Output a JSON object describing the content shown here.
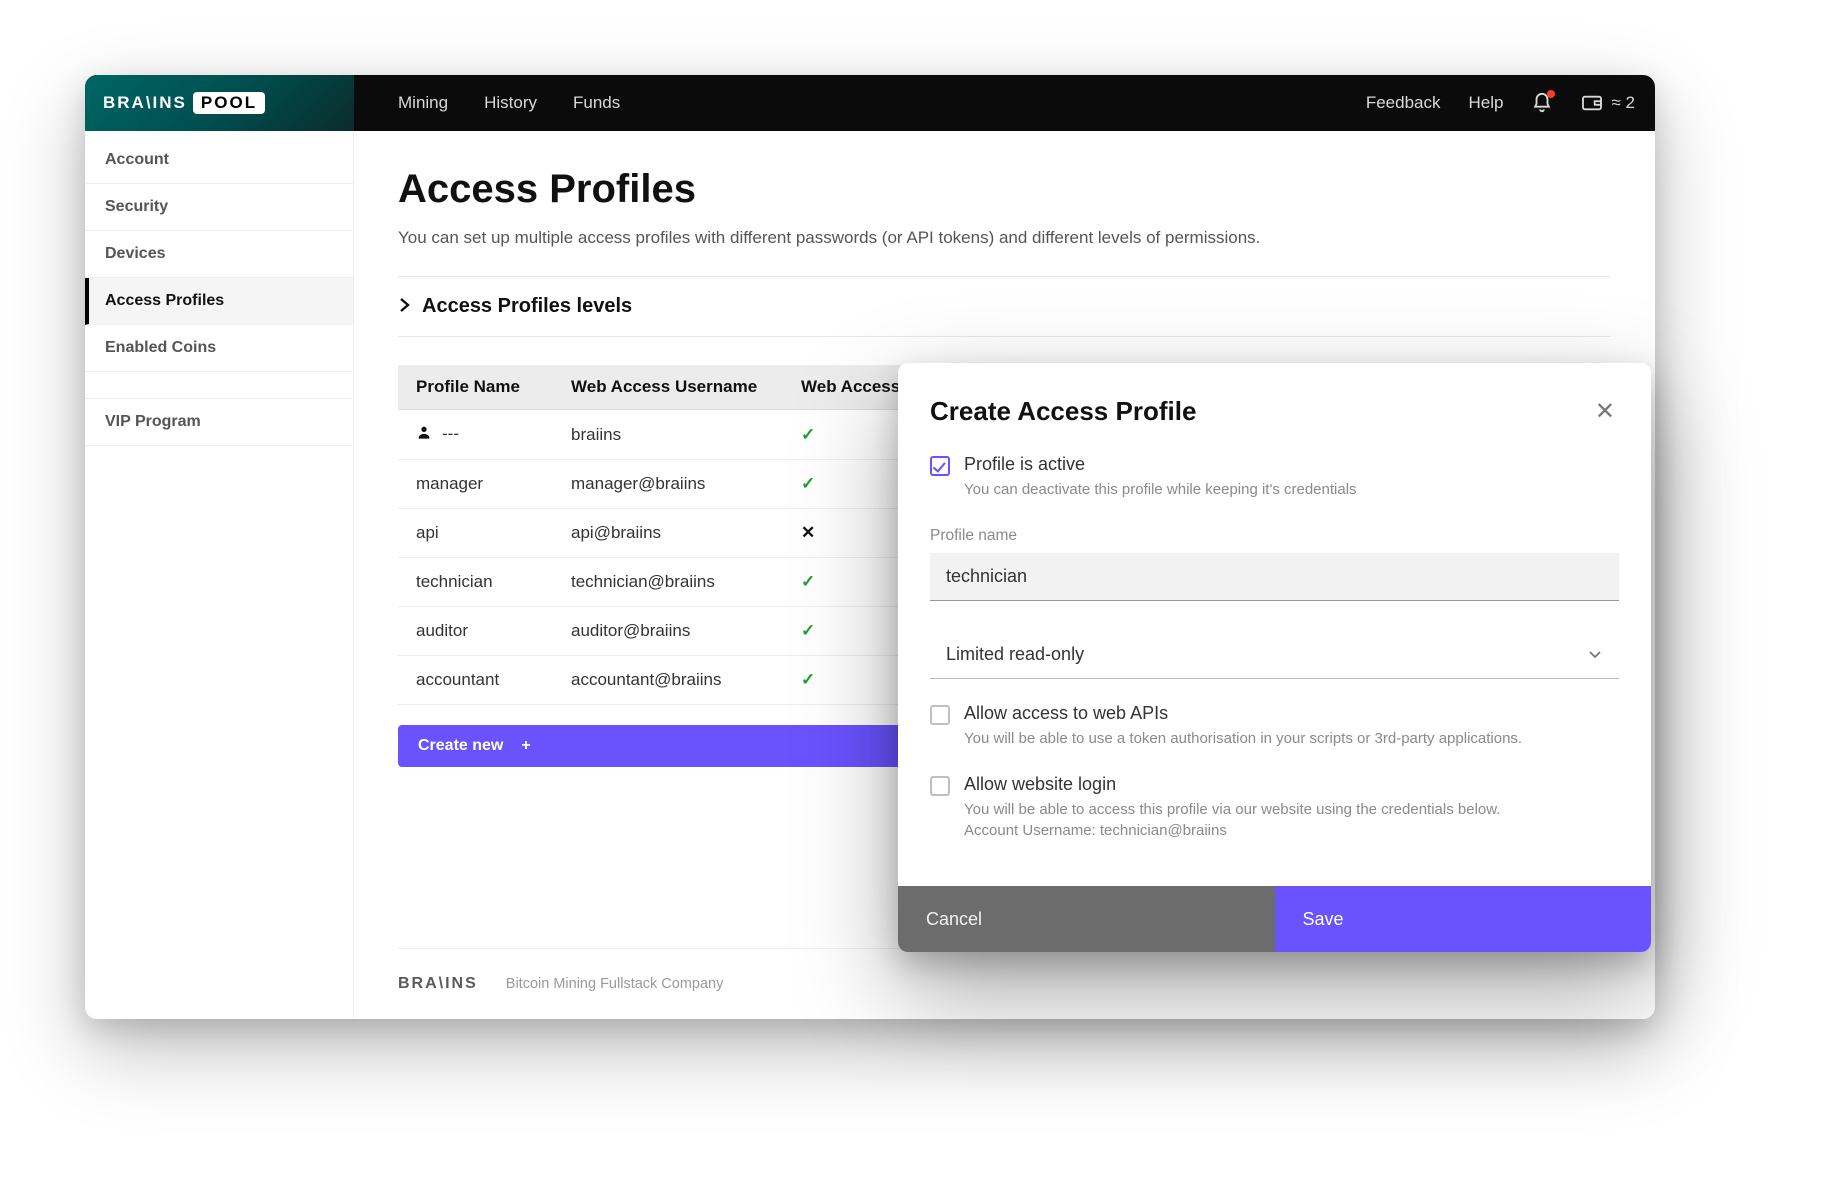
{
  "brand": {
    "left": "BRA\\INS",
    "pill": "POOL"
  },
  "nav": [
    "Mining",
    "History",
    "Funds"
  ],
  "topright": {
    "feedback": "Feedback",
    "help": "Help",
    "balance": "≈ 2"
  },
  "sidebar": {
    "items": [
      {
        "label": "Account"
      },
      {
        "label": "Security"
      },
      {
        "label": "Devices"
      },
      {
        "label": "Access Profiles",
        "active": true
      },
      {
        "label": "Enabled Coins"
      }
    ],
    "extra": {
      "label": "VIP Program"
    }
  },
  "page": {
    "title": "Access Profiles",
    "subtitle": "You can set up multiple access profiles with different passwords (or API tokens) and different levels of permissions.",
    "levels_toggle": "Access Profiles levels"
  },
  "table": {
    "headers": [
      "Profile Name",
      "Web Access Username",
      "Web Access"
    ],
    "rows": [
      {
        "icon": true,
        "name": "---",
        "user": "braiins",
        "web": true
      },
      {
        "icon": false,
        "name": "manager",
        "user": "manager@braiins",
        "web": true
      },
      {
        "icon": false,
        "name": "api",
        "user": "api@braiins",
        "web": false
      },
      {
        "icon": false,
        "name": "technician",
        "user": "technician@braiins",
        "web": true
      },
      {
        "icon": false,
        "name": "auditor",
        "user": "auditor@braiins",
        "web": true
      },
      {
        "icon": false,
        "name": "accountant",
        "user": "accountant@braiins",
        "web": true
      }
    ],
    "create_label": "Create new"
  },
  "footer": {
    "logo": "BRA\\INS",
    "tagline": "Bitcoin Mining Fullstack Company"
  },
  "modal": {
    "title": "Create Access Profile",
    "active": {
      "label": "Profile is active",
      "desc": "You can deactivate this profile while keeping it's credentials"
    },
    "profile_name_label": "Profile name",
    "profile_name_value": "technician",
    "permission_value": "Limited read-only",
    "api": {
      "label": "Allow access to web APIs",
      "desc": "You will be able to use a token authorisation in your scripts or 3rd-party applications."
    },
    "web": {
      "label": "Allow website login",
      "desc_line1": "You will be able to access this profile via our website using the credentials below.",
      "desc_line2": "Account Username: technician@braiins"
    },
    "cancel": "Cancel",
    "save": "Save"
  }
}
